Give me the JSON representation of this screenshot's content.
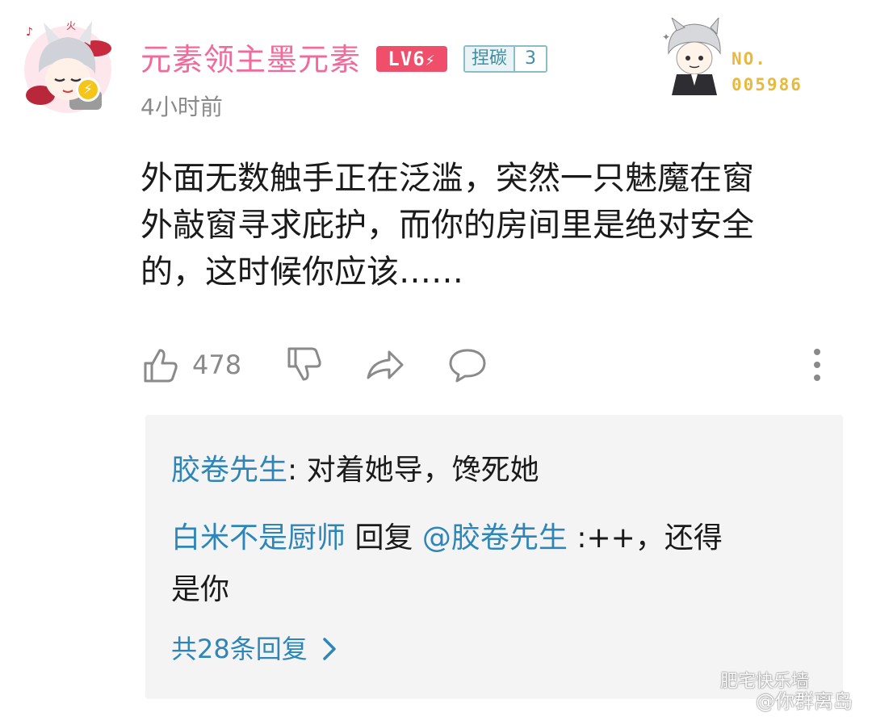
{
  "post": {
    "username": "元素领主墨元素",
    "level_badge": "LV6",
    "medal": {
      "name": "捏碳",
      "level": "3"
    },
    "time": "4小时前",
    "fan_card": {
      "label": "NO.",
      "number": "005986"
    },
    "content_lines": [
      "外面无数触手正在泛滥，突然一只魅魔在窗",
      "外敲窗寻求庇护，而你的房间里是绝对安全",
      "的，这时候你应该……"
    ],
    "actions": {
      "like_count": "478",
      "like_icon": "thumbs-up-icon",
      "dislike_icon": "thumbs-down-icon",
      "share_icon": "share-icon",
      "comment_icon": "comment-icon",
      "more_icon": "more-vertical-icon"
    }
  },
  "replies": [
    {
      "author": "胶卷先生",
      "sep": ": ",
      "text": "对着她导，馋死她"
    },
    {
      "author": "白米不是厨师",
      "verb": " 回复 ",
      "target": "@胶卷先生",
      "sep": " :",
      "text_line1": "++，还得",
      "text_line2": "是你"
    }
  ],
  "more_replies_label": "共28条回复",
  "watermark": {
    "line1": "肥宅快乐墙",
    "line2": "@你群离岛"
  },
  "colors": {
    "username": "#f06a9b",
    "level_badge": "#ef4f6a",
    "reply_name": "#2e86b8",
    "fan_number": "#e8b93c"
  }
}
